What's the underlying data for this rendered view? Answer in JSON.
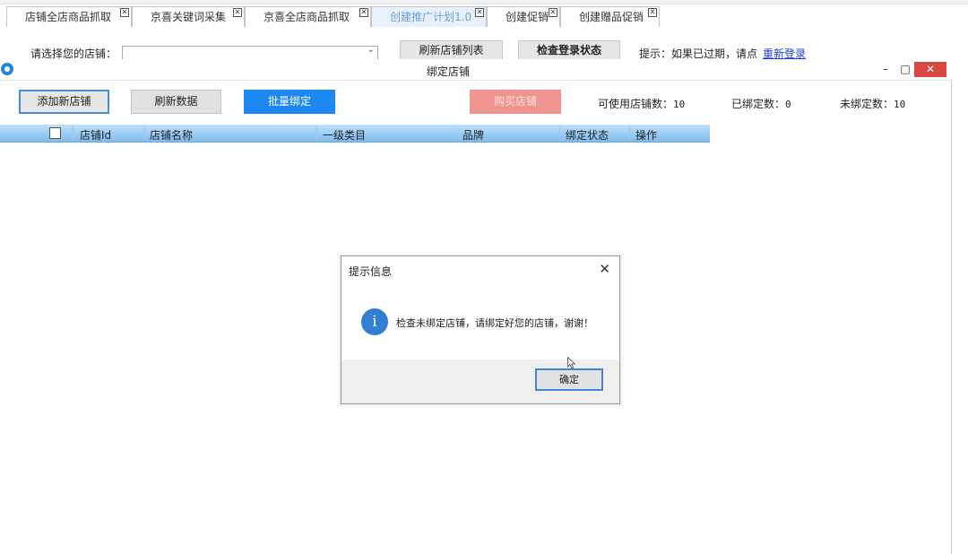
{
  "tabs": [
    {
      "label": "店铺全店商品抓取",
      "active": false
    },
    {
      "label": "京喜关键词采集",
      "active": false
    },
    {
      "label": "京喜全店商品抓取",
      "active": false
    },
    {
      "label": "创建推广计划1.0",
      "active": true
    },
    {
      "label": "创建促销",
      "active": false
    },
    {
      "label": "创建赠品促销",
      "active": false
    }
  ],
  "tab_close_glyph": "✕",
  "toolbar": {
    "store_label": "请选择您的店铺：",
    "store_value": "",
    "refresh_list_label": "刷新店铺列表",
    "check_login_label": "检查登录状态",
    "hint_label": "提示：如果已过期，请点",
    "relogin_link": "重新登录"
  },
  "window": {
    "title": "绑定店铺",
    "minimize_glyph": "–",
    "maximize_glyph": "□",
    "close_glyph": "✕",
    "buttons": {
      "add": "添加新店铺",
      "refresh": "刷新数据",
      "batch_bind": "批量绑定",
      "buy": "购买店铺"
    },
    "stats": {
      "available_label": "可使用店铺数：",
      "available_value": "10",
      "bound_label": "已绑定数：",
      "bound_value": "0",
      "unbound_label": "未绑定数：",
      "unbound_value": "10"
    },
    "grid_columns": [
      "店铺Id",
      "店铺名称",
      "一级类目",
      "品牌",
      "绑定状态",
      "操作"
    ]
  },
  "dialog": {
    "title": "提示信息",
    "close_glyph": "✕",
    "icon_glyph": "i",
    "message": "检查未绑定店铺，请绑定好您的店铺，谢谢！",
    "ok_label": "确定"
  },
  "colors": {
    "accent_blue": "#1d87f2",
    "buy_pink": "#f0948f",
    "close_red": "#d9473f",
    "link_blue": "#1f3fd6"
  }
}
